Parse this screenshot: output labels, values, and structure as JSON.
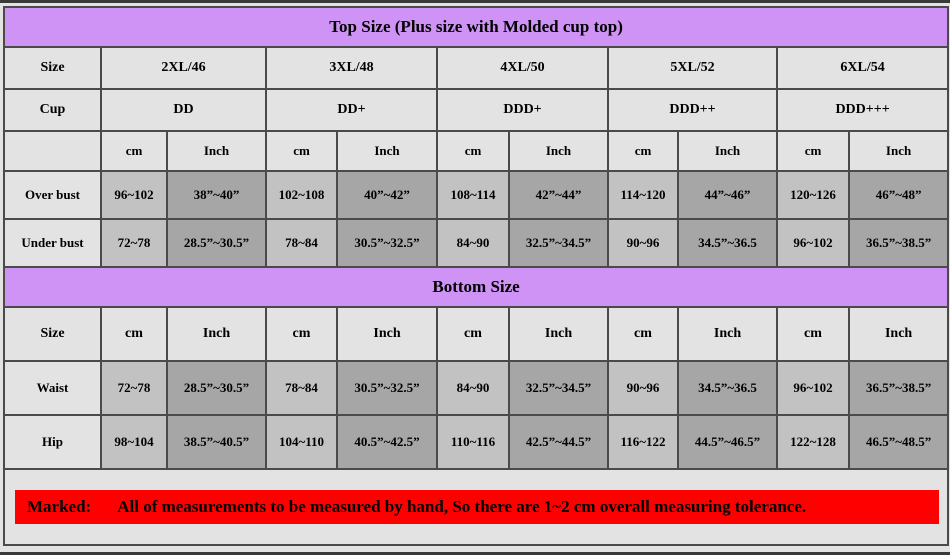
{
  "top_section": {
    "banner": "Top Size (Plus size with Molded cup top)",
    "row_labels": {
      "size": "Size",
      "cup": "Cup",
      "over_bust": "Over bust",
      "under_bust": "Under bust"
    },
    "units": {
      "cm": "cm",
      "inch": "Inch"
    },
    "sizes": [
      "2XL/46",
      "3XL/48",
      "4XL/50",
      "5XL/52",
      "6XL/54"
    ],
    "cups": [
      "DD",
      "DD+",
      "DDD+",
      "DDD++",
      "DDD+++"
    ],
    "over_bust": {
      "cm": [
        "96~102",
        "102~108",
        "108~114",
        "114~120",
        "120~126"
      ],
      "inch": [
        "38”~40”",
        "40”~42”",
        "42”~44”",
        "44”~46”",
        "46”~48”"
      ]
    },
    "under_bust": {
      "cm": [
        "72~78",
        "78~84",
        "84~90",
        "90~96",
        "96~102"
      ],
      "inch": [
        "28.5”~30.5”",
        "30.5”~32.5”",
        "32.5”~34.5”",
        "34.5”~36.5",
        "36.5”~38.5”"
      ]
    }
  },
  "bottom_section": {
    "banner": "Bottom Size",
    "row_labels": {
      "size": "Size",
      "waist": "Waist",
      "hip": "Hip"
    },
    "units": {
      "cm": "cm",
      "inch": "Inch"
    },
    "waist": {
      "cm": [
        "72~78",
        "78~84",
        "84~90",
        "90~96",
        "96~102"
      ],
      "inch": [
        "28.5”~30.5”",
        "30.5”~32.5”",
        "32.5”~34.5”",
        "34.5”~36.5",
        "36.5”~38.5”"
      ]
    },
    "hip": {
      "cm": [
        "98~104",
        "104~110",
        "110~116",
        "116~122",
        "122~128"
      ],
      "inch": [
        "38.5”~40.5”",
        "40.5”~42.5”",
        "42.5”~44.5”",
        "44.5”~46.5”",
        "46.5”~48.5”"
      ]
    }
  },
  "note": {
    "marked_label": "Marked:",
    "text": "All of measurements to be measured by hand, So there are 1~2 cm overall measuring tolerance."
  },
  "colors": {
    "banner_purple": "#cf92f5",
    "note_red": "#ff0000",
    "cell_light": "#e3e3e3",
    "cell_cm": "#c2c2c2",
    "cell_inch": "#a6a6a6",
    "border": "#4a4a4a"
  }
}
